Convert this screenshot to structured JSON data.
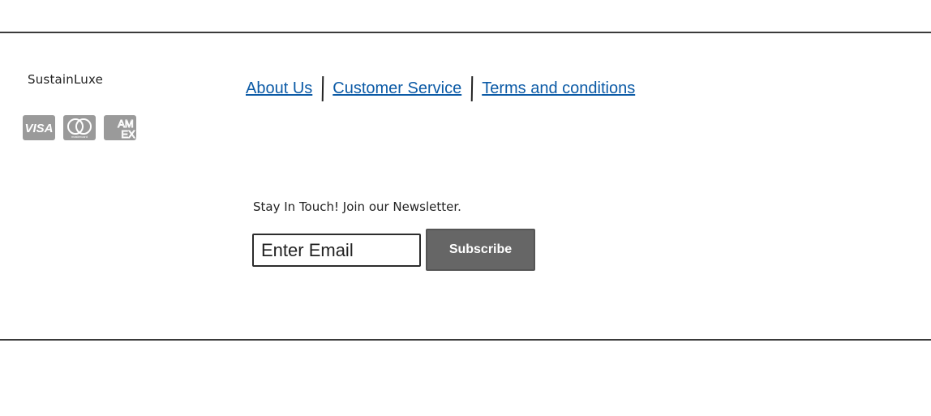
{
  "footer": {
    "brand": "SustainLuxe",
    "payment_icons": [
      "visa-icon",
      "mastercard-icon",
      "amex-icon"
    ],
    "payment_labels": {
      "visa": "VISA",
      "mastercard": "mastercard",
      "amex_top": "AM",
      "amex_bottom": "EX"
    },
    "links": [
      {
        "label": "About Us"
      },
      {
        "label": "Customer Service"
      },
      {
        "label": "Terms and conditions"
      }
    ],
    "newsletter": {
      "heading": "Stay In Touch! Join our Newsletter.",
      "email_placeholder": "Enter Email",
      "email_value": "",
      "subscribe_label": "Subscribe"
    },
    "colors": {
      "link": "#0b5aa6",
      "button_bg": "#666666",
      "card_bg": "#9a9a9a",
      "rule": "#3a3a3a"
    }
  }
}
